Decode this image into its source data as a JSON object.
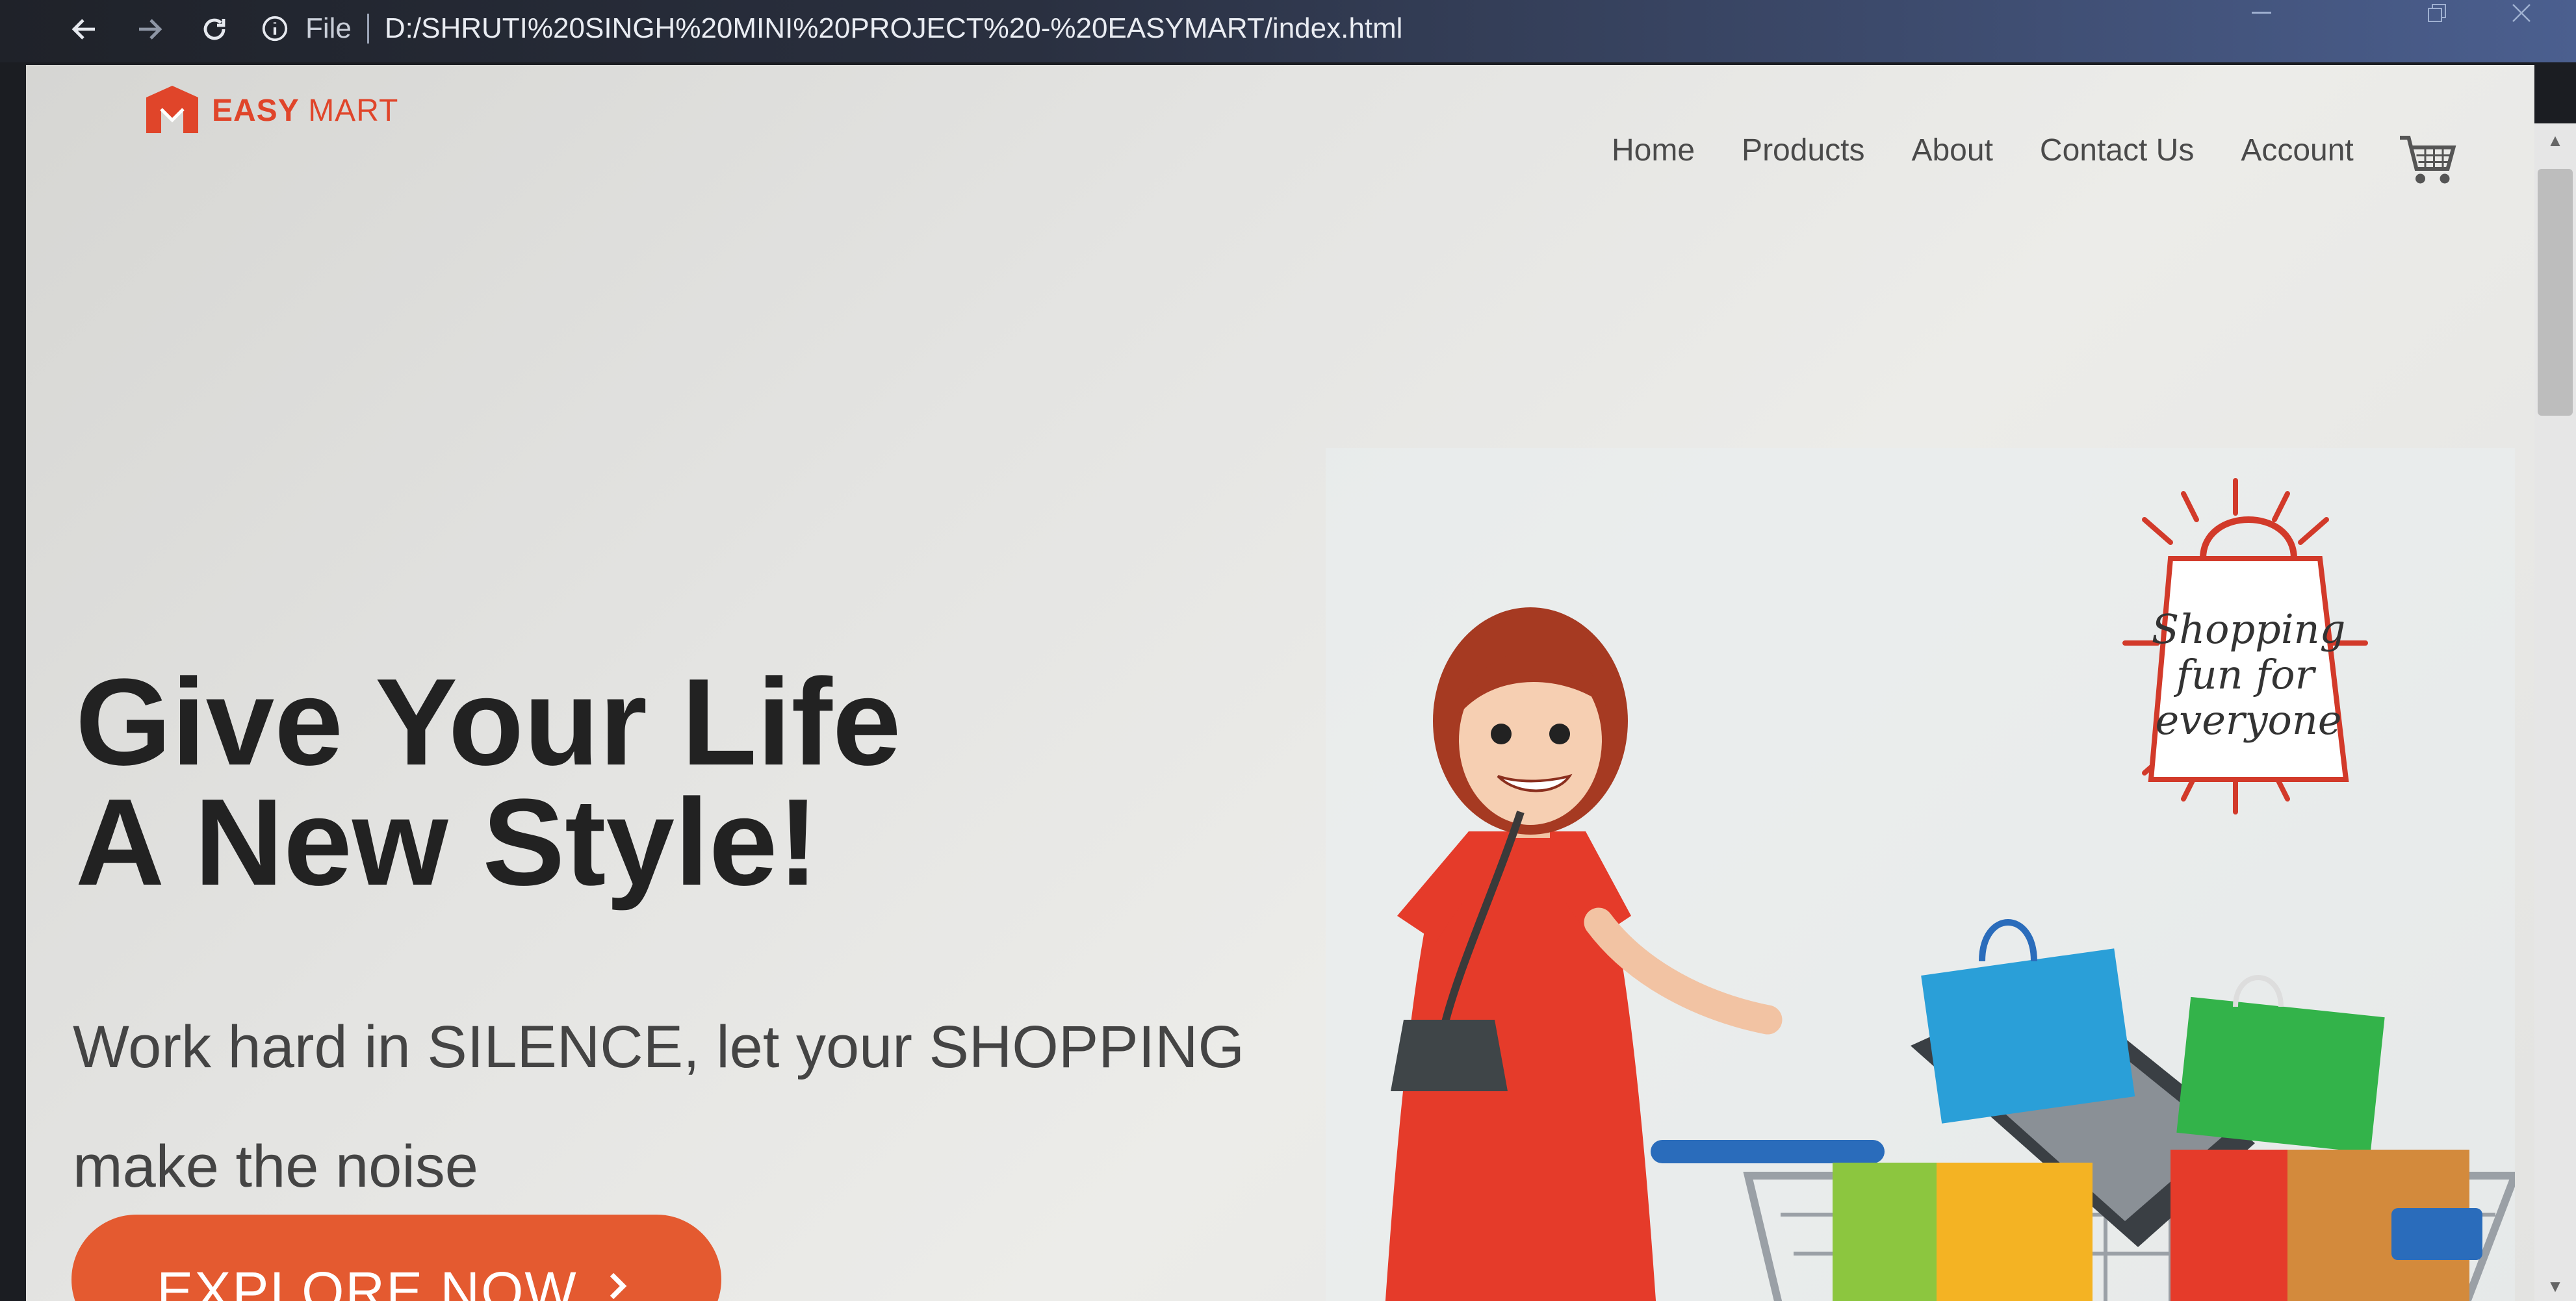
{
  "browser": {
    "address_prefix": "File",
    "url": "D:/SHRUTI%20SINGH%20MINI%20PROJECT%20-%20EASYMART/index.html"
  },
  "site": {
    "logo_bold": "EASY",
    "logo_light": "MART",
    "nav": [
      "Home",
      "Products",
      "About",
      "Contact Us",
      "Account"
    ]
  },
  "hero": {
    "title_line1": "Give Your Life",
    "title_line2": "A New Style!",
    "subtitle_line1": "Work hard in SILENCE, let your SHOPPING",
    "subtitle_line2": "make the noise",
    "cta_label": "EXPLORE NOW",
    "cta_icon": "arrow-right-icon"
  },
  "illustration": {
    "badge_line1": "Shopping",
    "badge_line2": "fun for",
    "badge_line3": "everyone"
  },
  "colors": {
    "brand": "#e0452a",
    "cta": "#e45a30",
    "dress": "#e53b2a"
  }
}
